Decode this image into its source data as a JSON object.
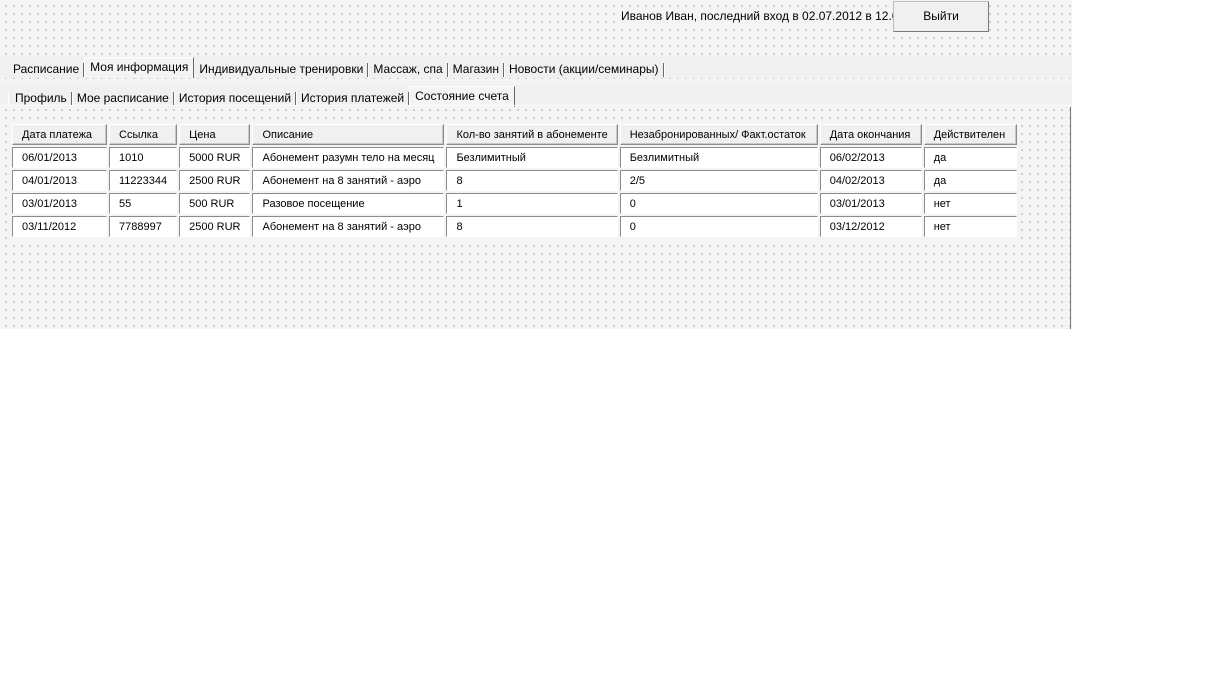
{
  "header": {
    "user_status": "Иванов Иван, последний вход в 02.07.2012 в 12.00",
    "logout_label": "Выйти"
  },
  "main_tabs": [
    {
      "label": "Расписание",
      "active": false
    },
    {
      "label": "Моя информация",
      "active": true
    },
    {
      "label": "Индивидуальные тренировки",
      "active": false
    },
    {
      "label": "Массаж, спа",
      "active": false
    },
    {
      "label": "Магазин",
      "active": false
    },
    {
      "label": "Новости (акции/семинары)",
      "active": false
    }
  ],
  "sub_tabs": [
    {
      "label": "Профиль",
      "active": false
    },
    {
      "label": "Мое расписание",
      "active": false
    },
    {
      "label": "История посещений",
      "active": false
    },
    {
      "label": "История платежей",
      "active": false
    },
    {
      "label": "Состояние счета",
      "active": true
    }
  ],
  "table": {
    "columns": [
      "Дата платежа",
      "Ссылка",
      "Цена",
      "Описание",
      "Кол-во занятий в абонементе",
      "Незабронированных/ Факт.остаток",
      "Дата окончания",
      "Действителен"
    ],
    "rows": [
      [
        "06/01/2013",
        "1010",
        "5000 RUR",
        "Абонемент разумн тело на месяц",
        "Безлимитный",
        "Безлимитный",
        "06/02/2013",
        "да"
      ],
      [
        "04/01/2013",
        "11223344",
        "2500 RUR",
        "Абонемент на 8 занятий - аэро",
        "8",
        "2/5",
        "04/02/2013",
        "да"
      ],
      [
        "03/01/2013",
        "55",
        "500 RUR",
        "Разовое посещение",
        "1",
        "0",
        "03/01/2013",
        "нет"
      ],
      [
        "03/11/2012",
        "7788997",
        "2500 RUR",
        "Абонемент на 8 занятий - аэро",
        "8",
        "0",
        "03/12/2012",
        "нет"
      ]
    ]
  }
}
